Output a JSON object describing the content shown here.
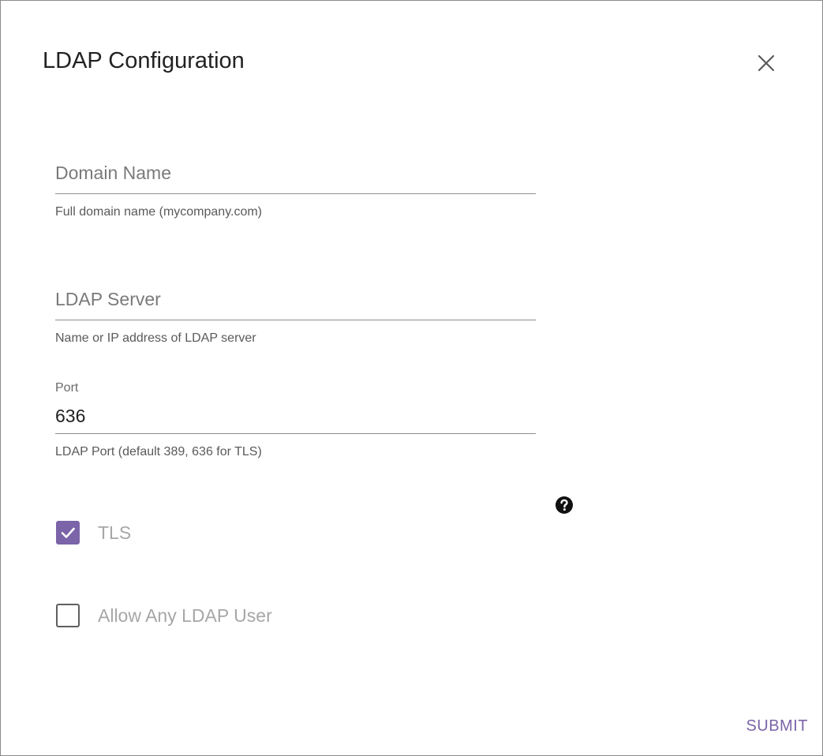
{
  "dialog": {
    "title": "LDAP Configuration",
    "close_icon": "close-icon"
  },
  "fields": {
    "domain": {
      "placeholder": "Domain Name",
      "value": "",
      "helper": "Full domain name (mycompany.com)"
    },
    "server": {
      "placeholder": "LDAP Server",
      "value": "",
      "helper": "Name or IP address of LDAP server"
    },
    "port": {
      "label": "Port",
      "value": "636",
      "helper": "LDAP Port (default 389, 636 for TLS)"
    }
  },
  "help_icon": "question-circle-icon",
  "options": {
    "tls": {
      "label": "TLS",
      "checked": true
    },
    "allow_any_user": {
      "label": "Allow Any LDAP User",
      "checked": false
    }
  },
  "actions": {
    "submit_label": "SUBMIT"
  },
  "colors": {
    "accent": "#7b64a8",
    "disabled_text": "#a7a7a7"
  }
}
